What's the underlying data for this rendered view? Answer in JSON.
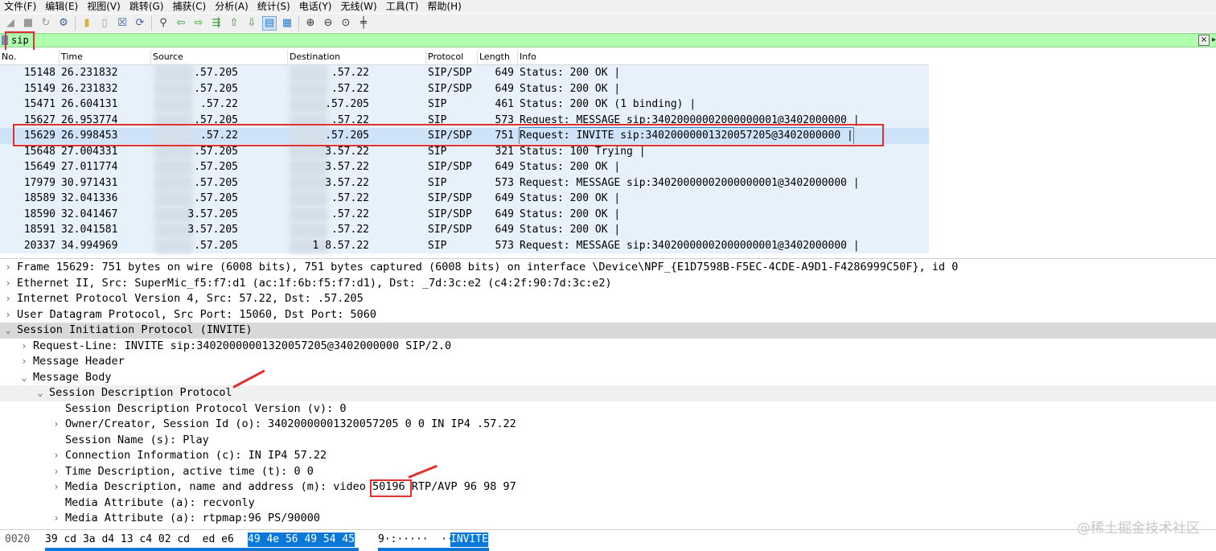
{
  "menu": [
    "文件(F)",
    "编辑(E)",
    "视图(V)",
    "跳转(G)",
    "捕获(C)",
    "分析(A)",
    "统计(S)",
    "电话(Y)",
    "无线(W)",
    "工具(T)",
    "帮助(H)"
  ],
  "toolbar_icons": [
    "start-capture-icon",
    "stop-capture-icon",
    "restart-capture-icon",
    "capture-options-icon",
    "open-file-icon",
    "save-file-icon",
    "close-file-icon",
    "reload-file-icon",
    "find-packet-icon",
    "go-back-icon",
    "go-forward-icon",
    "go-to-packet-icon",
    "go-first-icon",
    "go-last-icon",
    "auto-scroll-icon",
    "colorize-icon",
    "zoom-in-icon",
    "zoom-out-icon",
    "zoom-reset-icon",
    "resize-columns-icon"
  ],
  "filter": {
    "value": "sip"
  },
  "packet_list": {
    "columns": [
      "No.",
      "Time",
      "Source",
      "Destination",
      "Protocol",
      "Length",
      "Info"
    ],
    "rows": [
      {
        "no": "15148",
        "time": "26.231832",
        "src": ".57.205",
        "dst": ".57.22",
        "proto": "SIP/SDP",
        "len": "649",
        "info": "Status: 200 OK |"
      },
      {
        "no": "15149",
        "time": "26.231832",
        "src": ".57.205",
        "dst": ".57.22",
        "proto": "SIP/SDP",
        "len": "649",
        "info": "Status: 200 OK |"
      },
      {
        "no": "15471",
        "time": "26.604131",
        "src": ".57.22",
        "dst": ".57.205",
        "proto": "SIP",
        "len": "461",
        "info": "Status: 200 OK  (1 binding) |"
      },
      {
        "no": "15627",
        "time": "26.953774",
        "src": ".57.205",
        "dst": ".57.22",
        "proto": "SIP",
        "len": "573",
        "info": "Request: MESSAGE sip:34020000002000000001@3402000000 |"
      },
      {
        "no": "15629",
        "time": "26.998453",
        "src": ".57.22",
        "dst": ".57.205",
        "proto": "SIP/SDP",
        "len": "751",
        "info": "Request: INVITE sip:34020000001320057205@3402000000 |"
      },
      {
        "no": "15648",
        "time": "27.004331",
        "src": ".57.205",
        "dst": "3.57.22",
        "proto": "SIP",
        "len": "321",
        "info": "Status: 100 Trying |"
      },
      {
        "no": "15649",
        "time": "27.011774",
        "src": ".57.205",
        "dst": "3.57.22",
        "proto": "SIP/SDP",
        "len": "649",
        "info": "Status: 200 OK |"
      },
      {
        "no": "17979",
        "time": "30.971431",
        "src": ".57.205",
        "dst": "3.57.22",
        "proto": "SIP",
        "len": "573",
        "info": "Request: MESSAGE sip:34020000002000000001@3402000000 |"
      },
      {
        "no": "18589",
        "time": "32.041336",
        "src": ".57.205",
        "dst": ".57.22",
        "proto": "SIP/SDP",
        "len": "649",
        "info": "Status: 200 OK |"
      },
      {
        "no": "18590",
        "time": "32.041467",
        "src": "3.57.205",
        "dst": ".57.22",
        "proto": "SIP/SDP",
        "len": "649",
        "info": "Status: 200 OK |"
      },
      {
        "no": "18591",
        "time": "32.041581",
        "src": "3.57.205",
        "dst": ".57.22",
        "proto": "SIP/SDP",
        "len": "649",
        "info": "Status: 200 OK |"
      },
      {
        "no": "20337",
        "time": "34.994969",
        "src": ".57.205",
        "dst": "1  8.57.22",
        "proto": "SIP",
        "len": "573",
        "info": "Request: MESSAGE sip:34020000002000000001@3402000000 |"
      }
    ]
  },
  "details": [
    {
      "arrow": ">",
      "text": "Frame 15629: 751 bytes on wire (6008 bits), 751 bytes captured (6008 bits) on interface \\Device\\NPF_{E1D7598B-F5EC-4CDE-A9D1-F4286999C50F}, id 0"
    },
    {
      "arrow": ">",
      "text": "Ethernet II, Src: SuperMic_f5:f7:d1 (ac:1f:6b:f5:f7:d1), Dst:        _7d:3c:e2 (c4:2f:90:7d:3c:e2)"
    },
    {
      "arrow": ">",
      "text": "Internet Protocol Version 4, Src:      57.22, Dst:       .57.205"
    },
    {
      "arrow": ">",
      "text": "User Datagram Protocol, Src Port: 15060, Dst Port: 5060"
    },
    {
      "arrow": "v",
      "text": "Session Initiation Protocol (INVITE)"
    },
    {
      "arrow": ">",
      "text": "Request-Line: INVITE sip:34020000001320057205@3402000000 SIP/2.0"
    },
    {
      "arrow": ">",
      "text": "Message Header"
    },
    {
      "arrow": "v",
      "text": "Message Body"
    },
    {
      "arrow": "v",
      "text": "Session Description Protocol"
    },
    {
      "arrow": "",
      "text": "Session Description Protocol Version (v): 0"
    },
    {
      "arrow": ">",
      "text": "Owner/Creator, Session Id (o): 34020000001320057205 0 0 IN IP4        .57.22"
    },
    {
      "arrow": "",
      "text": "Session Name (s): Play"
    },
    {
      "arrow": ">",
      "text": "Connection Information (c): IN IP4        57.22"
    },
    {
      "arrow": ">",
      "text": "Time Description, active time (t): 0 0"
    },
    {
      "arrow": ">",
      "text": "Media Description, name and address (m): video 50196 RTP/AVP 96 98 97"
    },
    {
      "arrow": "",
      "text": "Media Attribute (a): recvonly"
    },
    {
      "arrow": ">",
      "text": "Media Attribute (a): rtpmap:96 PS/90000"
    }
  ],
  "bytes": {
    "offset": "0020",
    "hex_plain": "39 cd 3a d4 13 c4 02 cd  ed e6",
    "hex_selected": "49 4e 56 49 54 45",
    "ascii_plain": "9·:·····  ··",
    "ascii_selected": "INVITE"
  },
  "watermark": "@稀土掘金技术社区"
}
